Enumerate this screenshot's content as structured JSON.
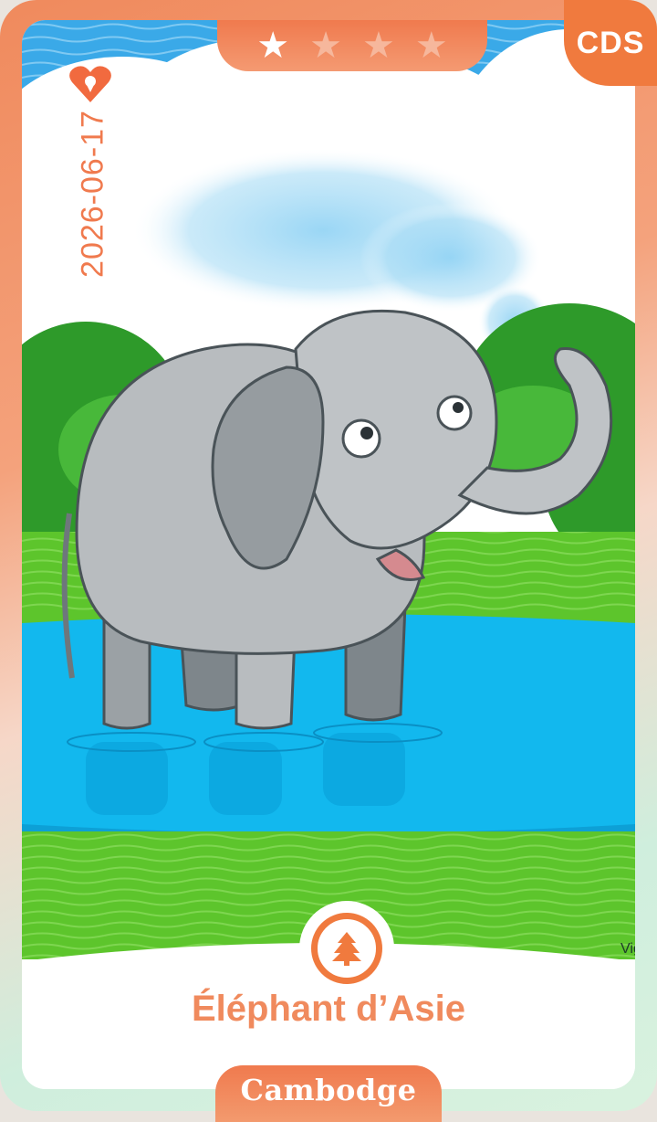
{
  "card": {
    "badge": "CDS",
    "date": "2026-06-17",
    "animal_name": "Éléphant d’Asie",
    "country": "Cambodge",
    "signature": "Vig",
    "rating": {
      "filled": 1,
      "total": 4
    },
    "habitat_icon": "tree-icon",
    "favorite_icon": "heart-location-icon"
  },
  "colors": {
    "accent": "#f07a3e",
    "sky": "#3aa9e8",
    "water": "#12b8ee",
    "grass": "#5dc52c",
    "elephant": "#b8bcbf"
  }
}
